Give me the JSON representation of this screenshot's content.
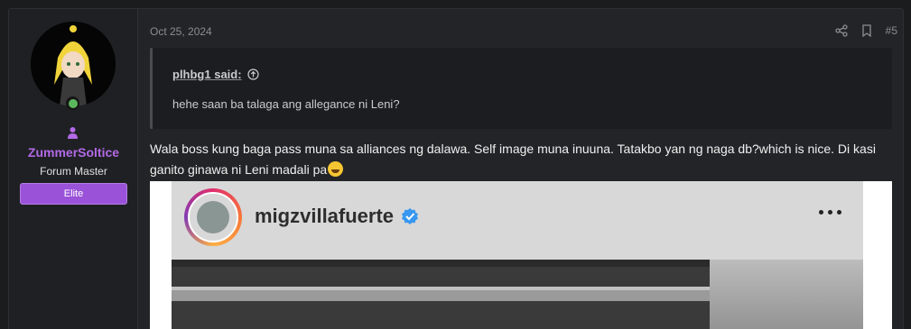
{
  "user": {
    "username": "ZummerSoltice",
    "title": "Forum Master",
    "badge": "Elite"
  },
  "post": {
    "date": "Oct 25, 2024",
    "number": "#5",
    "quote": {
      "author": "plhbg1 said:",
      "text": "hehe saan ba talaga ang allegance ni Leni?"
    },
    "message": "Wala boss kung baga pass muna sa alliances ng dalawa. Self image muna inuuna. Tatakbo yan ng naga db?which is nice. Di kasi ganito ginawa ni Leni madali pa"
  },
  "embed": {
    "ig_username": "migzvillafuerte"
  },
  "colors": {
    "username": "#b26ae6",
    "badge": "#9a52d8",
    "online": "#5cb85c",
    "verified": "#3897f0"
  },
  "icons": [
    "user-icon",
    "share-icon",
    "bookmark-icon",
    "arrow-up-circle-icon",
    "rofl-emoji-icon",
    "verified-badge-icon",
    "more-dots-icon"
  ]
}
